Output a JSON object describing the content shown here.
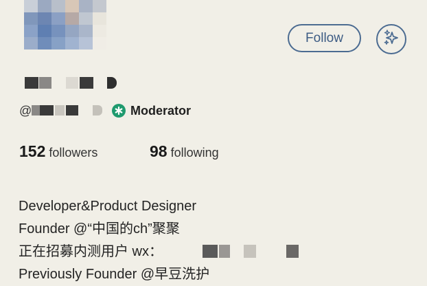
{
  "profile": {
    "handle_prefix": "@",
    "role_badge": "Moderator",
    "role_icon": "asterisk-badge-icon",
    "role_color": "#1f9a6e"
  },
  "actions": {
    "follow_label": "Follow",
    "ai_icon": "sparkles-icon",
    "accent": "#4b6b91"
  },
  "stats": {
    "followers_count": "152",
    "followers_label": "followers",
    "following_count": "98",
    "following_label": "following"
  },
  "bio": {
    "line1": "Developer&Product Designer",
    "line2": "Founder @“中国的ch”聚聚",
    "line3": "正在招募内测用户 wx：",
    "line4": "Previously Founder @早豆洗护"
  }
}
